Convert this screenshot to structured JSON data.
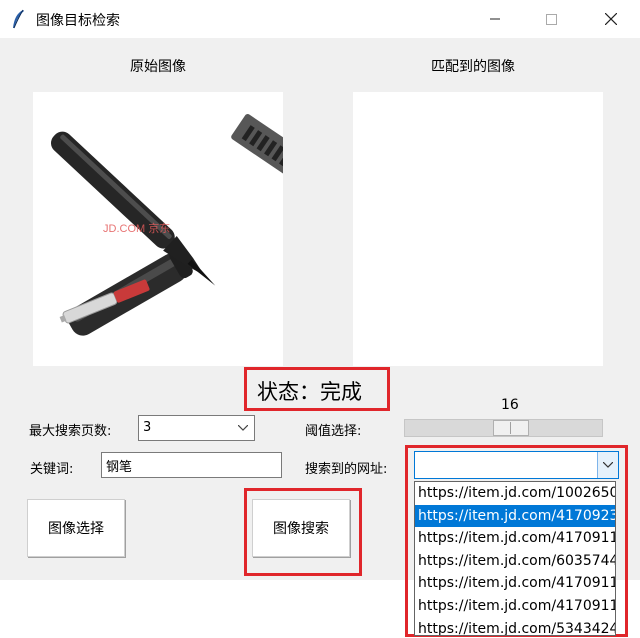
{
  "window": {
    "title": "图像目标检索",
    "icons": [
      "feather-icon",
      "minimize-icon",
      "maximize-icon",
      "close-icon"
    ]
  },
  "headers": {
    "original": "原始图像",
    "matched": "匹配到的图像"
  },
  "original_image": {
    "watermark": "JD.COM 京东"
  },
  "status": {
    "text": "状态：完成"
  },
  "threshold": {
    "label": "阈值选择:",
    "value": "16"
  },
  "max_pages": {
    "label": "最大搜索页数:",
    "value": "3"
  },
  "keyword": {
    "label": "关键词:",
    "value": "钢笔"
  },
  "urls": {
    "label": "搜索到的网址:",
    "value": "",
    "options": [
      "https://item.jd.com/1002650",
      "https://item.jd.com/4170923",
      "https://item.jd.com/4170911",
      "https://item.jd.com/6035744",
      "https://item.jd.com/4170911",
      "https://item.jd.com/4170911",
      "https://item.jd.com/5343424"
    ],
    "selected_index": 1
  },
  "buttons": {
    "select_image": "图像选择",
    "search_image": "图像搜索"
  }
}
